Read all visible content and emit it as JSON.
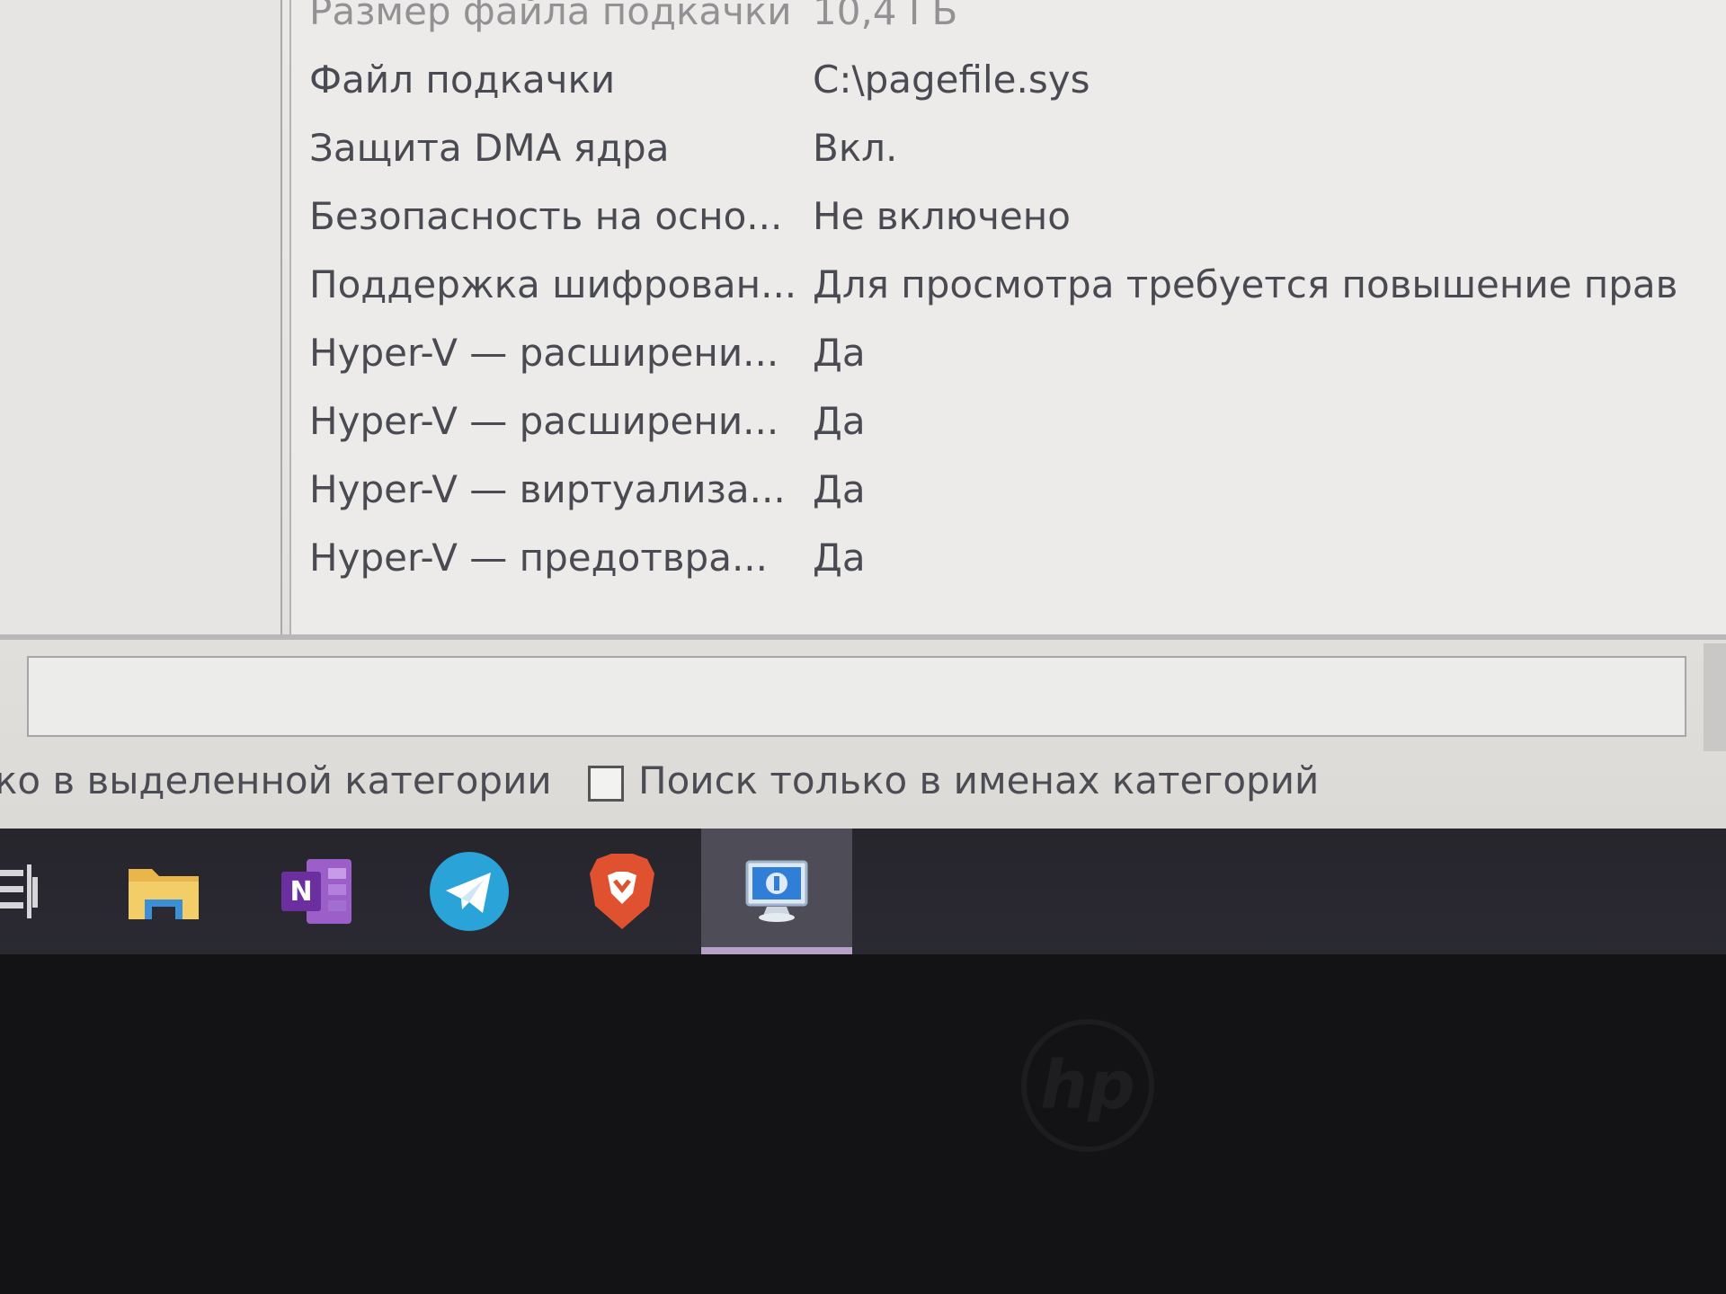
{
  "details": {
    "rows": [
      {
        "name": "Размер файла подкачки",
        "value": "10,4 ГБ"
      },
      {
        "name": "Файл подкачки",
        "value": "C:\\pagefile.sys"
      },
      {
        "name": "Защита DMA ядра",
        "value": "Вкл."
      },
      {
        "name": "Безопасность на осно...",
        "value": "Не включено"
      },
      {
        "name": "Поддержка шифрован...",
        "value": "Для просмотра требуется повышение прав"
      },
      {
        "name": "Hyper-V — расширени...",
        "value": "Да"
      },
      {
        "name": "Hyper-V — расширени...",
        "value": "Да"
      },
      {
        "name": "Hyper-V — виртуализа...",
        "value": "Да"
      },
      {
        "name": "Hyper-V — предотвра...",
        "value": "Да"
      }
    ]
  },
  "find": {
    "search_value": "",
    "option_selected_category": "ко в выделенной категории",
    "option_category_names": "Поиск только в именах категорий",
    "option_category_names_checked": false
  },
  "taskbar": {
    "items": [
      {
        "icon": "task-view-icon"
      },
      {
        "icon": "file-explorer-icon"
      },
      {
        "icon": "onenote-icon",
        "letter": "N"
      },
      {
        "icon": "telegram-icon"
      },
      {
        "icon": "brave-browser-icon"
      },
      {
        "icon": "system-information-icon",
        "active": true
      }
    ]
  },
  "bezel": {
    "logo": "hp"
  },
  "colors": {
    "window_bg": "#e9e8e6",
    "text": "#4a4a52",
    "taskbar_bg": "#2b2a33",
    "active_indicator": "#b7a1c9",
    "telegram": "#2aa3d8",
    "brave": "#e0522f",
    "onenote": "#7b3fa8",
    "explorer": "#e8b64a"
  }
}
